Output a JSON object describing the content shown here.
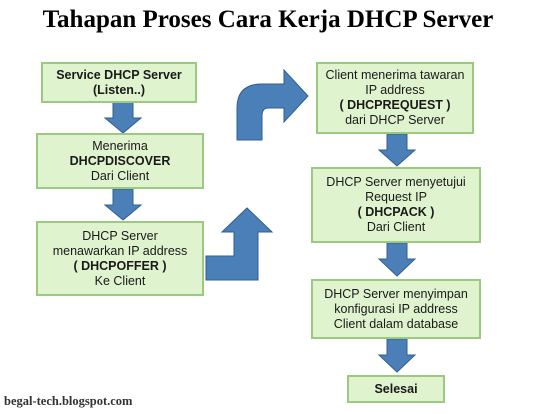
{
  "title": "Tahapan Proses Cara Kerja DHCP Server",
  "left_steps": [
    {
      "lines": [
        "Service DHCP Server",
        "(Listen..)"
      ]
    },
    {
      "lines": [
        "Menerima",
        "DHCPDISCOVER",
        "Dari Client"
      ]
    },
    {
      "lines": [
        "DHCP Server",
        "menawarkan IP address",
        "( DHCPOFFER )",
        "Ke Client"
      ]
    }
  ],
  "right_steps": [
    {
      "lines": [
        "Client menerima tawaran",
        "IP address",
        "( DHCPREQUEST )",
        "dari DHCP Server"
      ]
    },
    {
      "lines": [
        "DHCP Server menyetujui",
        "Request IP",
        "( DHCPACK )",
        "Dari Client"
      ]
    },
    {
      "lines": [
        "DHCP Server menyimpan",
        "konfigurasi IP address",
        "Client dalam database"
      ]
    },
    {
      "lines": [
        "Selesai"
      ]
    }
  ],
  "footer": "begal-tech.blogspot.com",
  "colors": {
    "box_fill": "#dff3cf",
    "box_border": "#9bc97f",
    "arrow_fill": "#4b7fb8",
    "arrow_stroke": "#2f5f93"
  }
}
